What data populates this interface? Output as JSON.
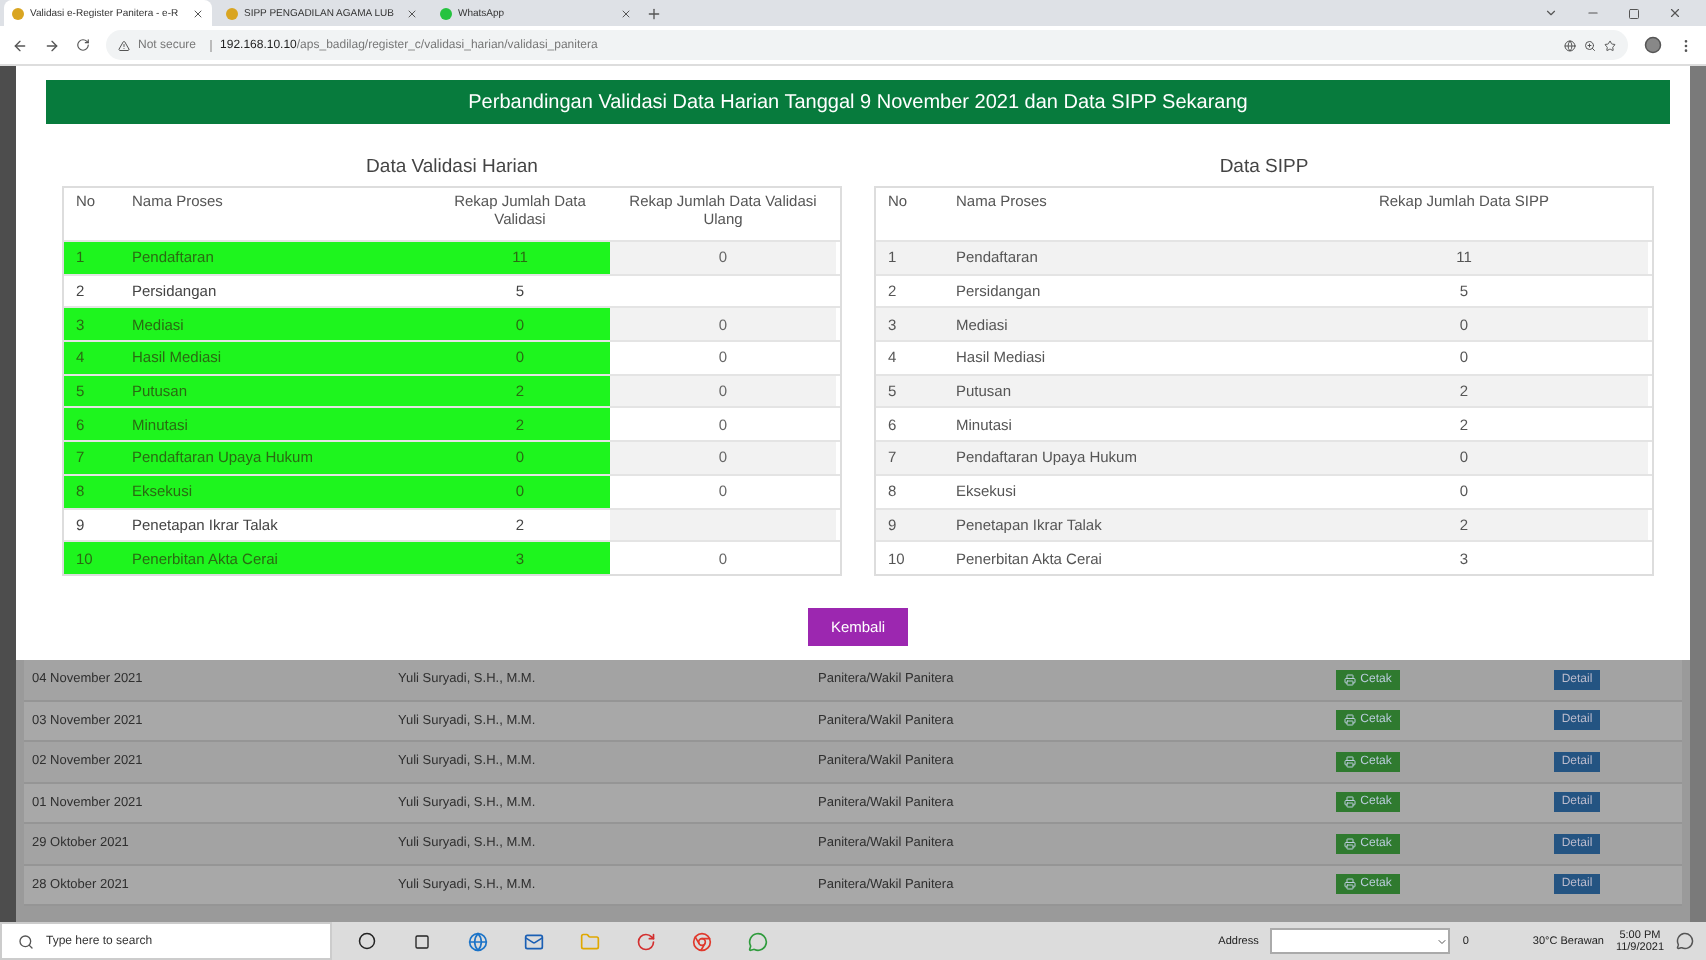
{
  "browser": {
    "tabs": [
      {
        "title": "Validasi e-Register Panitera - e-R",
        "selected": true
      },
      {
        "title": "SIPP PENGADILAN AGAMA LUB",
        "selected": false
      },
      {
        "title": "WhatsApp",
        "selected": false
      }
    ],
    "security": "Not secure",
    "host": "192.168.10.10",
    "path": "/aps_badilag/register_c/validasi_harian/validasi_panitera"
  },
  "modal": {
    "title": "Perbandingan Validasi Data Harian Tanggal 9 November 2021 dan Data SIPP Sekarang",
    "left_table": {
      "title": "Data Validasi Harian",
      "columns": [
        "No",
        "Nama Proses",
        "Rekap Jumlah Data Validasi",
        "Rekap Jumlah Data Validasi Ulang"
      ],
      "rows": [
        {
          "no": "1",
          "name": "Pendaftaran",
          "count": "11",
          "recheck": "0",
          "validated": true
        },
        {
          "no": "2",
          "name": "Persidangan",
          "count": "5",
          "validated": false
        },
        {
          "no": "3",
          "name": "Mediasi",
          "count": "0",
          "recheck": "0",
          "validated": true
        },
        {
          "no": "4",
          "name": "Hasil Mediasi",
          "count": "0",
          "recheck": "0",
          "validated": true
        },
        {
          "no": "5",
          "name": "Putusan",
          "count": "2",
          "recheck": "0",
          "validated": true
        },
        {
          "no": "6",
          "name": "Minutasi",
          "count": "2",
          "recheck": "0",
          "validated": true
        },
        {
          "no": "7",
          "name": "Pendaftaran Upaya Hukum",
          "count": "0",
          "recheck": "0",
          "validated": true
        },
        {
          "no": "8",
          "name": "Eksekusi",
          "count": "0",
          "recheck": "0",
          "validated": true
        },
        {
          "no": "9",
          "name": "Penetapan Ikrar Talak",
          "count": "2",
          "validated": false
        },
        {
          "no": "10",
          "name": "Penerbitan Akta Cerai",
          "count": "3",
          "recheck": "0",
          "validated": true
        }
      ]
    },
    "right_table": {
      "title": "Data SIPP",
      "columns": [
        "No",
        "Nama Proses",
        "Rekap Jumlah Data SIPP"
      ],
      "rows": [
        {
          "no": "1",
          "name": "Pendaftaran",
          "count": "11"
        },
        {
          "no": "2",
          "name": "Persidangan",
          "count": "5"
        },
        {
          "no": "3",
          "name": "Mediasi",
          "count": "0"
        },
        {
          "no": "4",
          "name": "Hasil Mediasi",
          "count": "0"
        },
        {
          "no": "5",
          "name": "Putusan",
          "count": "2"
        },
        {
          "no": "6",
          "name": "Minutasi",
          "count": "2"
        },
        {
          "no": "7",
          "name": "Pendaftaran Upaya Hukum",
          "count": "0"
        },
        {
          "no": "8",
          "name": "Eksekusi",
          "count": "0"
        },
        {
          "no": "9",
          "name": "Penetapan Ikrar Talak",
          "count": "2"
        },
        {
          "no": "10",
          "name": "Penerbitan Akta Cerai",
          "count": "3"
        }
      ]
    },
    "button": "Kembali"
  },
  "background_table": {
    "rows": [
      {
        "date": "04 November 2021",
        "name": "Yuli Suryadi, S.H., M.M.",
        "role": "Panitera/Wakil Panitera",
        "print": "Cetak",
        "detail": "Detail"
      },
      {
        "date": "03 November 2021",
        "name": "Yuli Suryadi, S.H., M.M.",
        "role": "Panitera/Wakil Panitera",
        "print": "Cetak",
        "detail": "Detail"
      },
      {
        "date": "02 November 2021",
        "name": "Yuli Suryadi, S.H., M.M.",
        "role": "Panitera/Wakil Panitera",
        "print": "Cetak",
        "detail": "Detail"
      },
      {
        "date": "01 November 2021",
        "name": "Yuli Suryadi, S.H., M.M.",
        "role": "Panitera/Wakil Panitera",
        "print": "Cetak",
        "detail": "Detail"
      },
      {
        "date": "29 Oktober 2021",
        "name": "Yuli Suryadi, S.H., M.M.",
        "role": "Panitera/Wakil Panitera",
        "print": "Cetak",
        "detail": "Detail"
      },
      {
        "date": "28 Oktober 2021",
        "name": "Yuli Suryadi, S.H., M.M.",
        "role": "Panitera/Wakil Panitera",
        "print": "Cetak",
        "detail": "Detail"
      }
    ]
  },
  "taskbar": {
    "search_placeholder": "Type here to search",
    "address_label": "Address",
    "address_go": "0",
    "weather": "30°C  Berawan",
    "time": "5:00 PM",
    "date": "11/9/2021"
  }
}
